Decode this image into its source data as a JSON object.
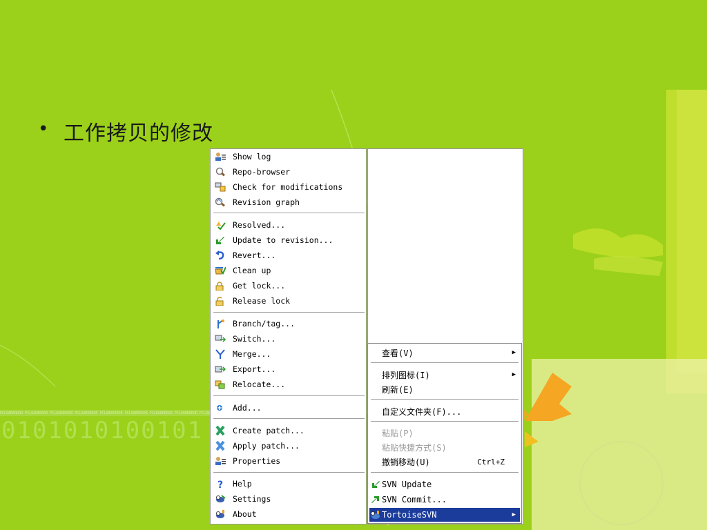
{
  "slide": {
    "bullet": "•",
    "title": "工作拷贝的修改",
    "binary": "0101010100101",
    "strip": "PCLOADERROR PCLOADERROR PCLOADERROR PCLOADERROR PCLOADERROR PCLOADERROR PCLOADERROR PCLOADERROR PCLOADERROR PCLOADERROR PCLOADERROR PCLOADERROR PCLOADERROR PCLOADERROR PCLOADERROR PCLOADERROR"
  },
  "svn_menu": {
    "items": [
      {
        "label": "Show log",
        "icon": "show-log-icon"
      },
      {
        "label": "Repo-browser",
        "icon": "repo-browser-icon"
      },
      {
        "label": "Check for modifications",
        "icon": "check-modifications-icon"
      },
      {
        "label": "Revision graph",
        "icon": "revision-graph-icon"
      },
      {
        "label": "Resolved...",
        "icon": "resolved-icon"
      },
      {
        "label": "Update to revision...",
        "icon": "update-revision-icon"
      },
      {
        "label": "Revert...",
        "icon": "revert-icon"
      },
      {
        "label": "Clean up",
        "icon": "cleanup-icon"
      },
      {
        "label": "Get lock...",
        "icon": "lock-icon"
      },
      {
        "label": "Release lock",
        "icon": "unlock-icon"
      },
      {
        "label": "Branch/tag...",
        "icon": "branch-icon"
      },
      {
        "label": "Switch...",
        "icon": "switch-icon"
      },
      {
        "label": "Merge...",
        "icon": "merge-icon"
      },
      {
        "label": "Export...",
        "icon": "export-icon"
      },
      {
        "label": "Relocate...",
        "icon": "relocate-icon"
      },
      {
        "label": "Add...",
        "icon": "add-icon"
      },
      {
        "label": "Create patch...",
        "icon": "create-patch-icon"
      },
      {
        "label": "Apply patch...",
        "icon": "apply-patch-icon"
      },
      {
        "label": "Properties",
        "icon": "properties-icon"
      },
      {
        "label": "Help",
        "icon": "help-icon"
      },
      {
        "label": "Settings",
        "icon": "settings-icon"
      },
      {
        "label": "About",
        "icon": "about-icon"
      }
    ]
  },
  "context_menu": {
    "view": "查看(V)",
    "arrange_icons": "排列图标(I)",
    "refresh": "刷新(E)",
    "customize_folder": "自定义文件夹(F)...",
    "paste": "粘贴(P)",
    "paste_shortcut": "粘贴快捷方式(S)",
    "undo_move": "撤销移动(U)",
    "undo_shortcut": "Ctrl+Z",
    "svn_update": "SVN Update",
    "svn_commit": "SVN Commit...",
    "tortoise": "TortoiseSVN",
    "submenu_arrow": "▶"
  },
  "colors": {
    "background": "#9bd11a",
    "selection": "#1c3c9c",
    "accent_orange": "#f5a623"
  }
}
